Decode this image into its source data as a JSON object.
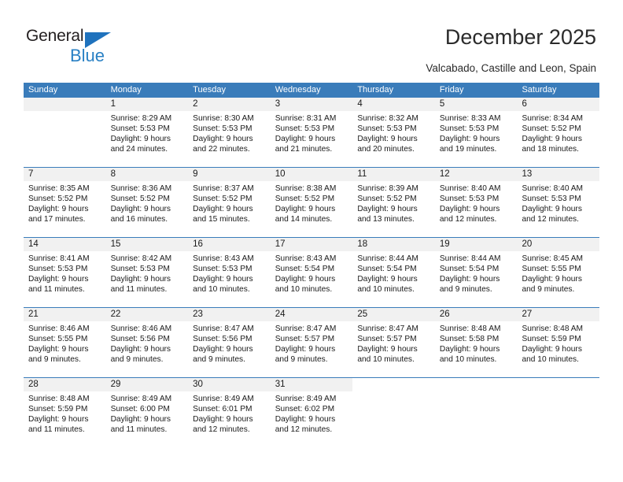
{
  "brand": {
    "name_top": "General",
    "name_bottom": "Blue",
    "accent_color": "#2980c4",
    "triangle_color": "#1f72bd"
  },
  "header": {
    "title": "December 2025",
    "subtitle": "Valcabado, Castille and Leon, Spain"
  },
  "calendar": {
    "header_bg": "#3a7cba",
    "daynum_bg": "#f1f1f1",
    "weekdays": [
      "Sunday",
      "Monday",
      "Tuesday",
      "Wednesday",
      "Thursday",
      "Friday",
      "Saturday"
    ],
    "weeks": [
      [
        {
          "day": "",
          "lines": []
        },
        {
          "day": "1",
          "lines": [
            "Sunrise: 8:29 AM",
            "Sunset: 5:53 PM",
            "Daylight: 9 hours",
            "and 24 minutes."
          ]
        },
        {
          "day": "2",
          "lines": [
            "Sunrise: 8:30 AM",
            "Sunset: 5:53 PM",
            "Daylight: 9 hours",
            "and 22 minutes."
          ]
        },
        {
          "day": "3",
          "lines": [
            "Sunrise: 8:31 AM",
            "Sunset: 5:53 PM",
            "Daylight: 9 hours",
            "and 21 minutes."
          ]
        },
        {
          "day": "4",
          "lines": [
            "Sunrise: 8:32 AM",
            "Sunset: 5:53 PM",
            "Daylight: 9 hours",
            "and 20 minutes."
          ]
        },
        {
          "day": "5",
          "lines": [
            "Sunrise: 8:33 AM",
            "Sunset: 5:53 PM",
            "Daylight: 9 hours",
            "and 19 minutes."
          ]
        },
        {
          "day": "6",
          "lines": [
            "Sunrise: 8:34 AM",
            "Sunset: 5:52 PM",
            "Daylight: 9 hours",
            "and 18 minutes."
          ]
        }
      ],
      [
        {
          "day": "7",
          "lines": [
            "Sunrise: 8:35 AM",
            "Sunset: 5:52 PM",
            "Daylight: 9 hours",
            "and 17 minutes."
          ]
        },
        {
          "day": "8",
          "lines": [
            "Sunrise: 8:36 AM",
            "Sunset: 5:52 PM",
            "Daylight: 9 hours",
            "and 16 minutes."
          ]
        },
        {
          "day": "9",
          "lines": [
            "Sunrise: 8:37 AM",
            "Sunset: 5:52 PM",
            "Daylight: 9 hours",
            "and 15 minutes."
          ]
        },
        {
          "day": "10",
          "lines": [
            "Sunrise: 8:38 AM",
            "Sunset: 5:52 PM",
            "Daylight: 9 hours",
            "and 14 minutes."
          ]
        },
        {
          "day": "11",
          "lines": [
            "Sunrise: 8:39 AM",
            "Sunset: 5:52 PM",
            "Daylight: 9 hours",
            "and 13 minutes."
          ]
        },
        {
          "day": "12",
          "lines": [
            "Sunrise: 8:40 AM",
            "Sunset: 5:53 PM",
            "Daylight: 9 hours",
            "and 12 minutes."
          ]
        },
        {
          "day": "13",
          "lines": [
            "Sunrise: 8:40 AM",
            "Sunset: 5:53 PM",
            "Daylight: 9 hours",
            "and 12 minutes."
          ]
        }
      ],
      [
        {
          "day": "14",
          "lines": [
            "Sunrise: 8:41 AM",
            "Sunset: 5:53 PM",
            "Daylight: 9 hours",
            "and 11 minutes."
          ]
        },
        {
          "day": "15",
          "lines": [
            "Sunrise: 8:42 AM",
            "Sunset: 5:53 PM",
            "Daylight: 9 hours",
            "and 11 minutes."
          ]
        },
        {
          "day": "16",
          "lines": [
            "Sunrise: 8:43 AM",
            "Sunset: 5:53 PM",
            "Daylight: 9 hours",
            "and 10 minutes."
          ]
        },
        {
          "day": "17",
          "lines": [
            "Sunrise: 8:43 AM",
            "Sunset: 5:54 PM",
            "Daylight: 9 hours",
            "and 10 minutes."
          ]
        },
        {
          "day": "18",
          "lines": [
            "Sunrise: 8:44 AM",
            "Sunset: 5:54 PM",
            "Daylight: 9 hours",
            "and 10 minutes."
          ]
        },
        {
          "day": "19",
          "lines": [
            "Sunrise: 8:44 AM",
            "Sunset: 5:54 PM",
            "Daylight: 9 hours",
            "and 9 minutes."
          ]
        },
        {
          "day": "20",
          "lines": [
            "Sunrise: 8:45 AM",
            "Sunset: 5:55 PM",
            "Daylight: 9 hours",
            "and 9 minutes."
          ]
        }
      ],
      [
        {
          "day": "21",
          "lines": [
            "Sunrise: 8:46 AM",
            "Sunset: 5:55 PM",
            "Daylight: 9 hours",
            "and 9 minutes."
          ]
        },
        {
          "day": "22",
          "lines": [
            "Sunrise: 8:46 AM",
            "Sunset: 5:56 PM",
            "Daylight: 9 hours",
            "and 9 minutes."
          ]
        },
        {
          "day": "23",
          "lines": [
            "Sunrise: 8:47 AM",
            "Sunset: 5:56 PM",
            "Daylight: 9 hours",
            "and 9 minutes."
          ]
        },
        {
          "day": "24",
          "lines": [
            "Sunrise: 8:47 AM",
            "Sunset: 5:57 PM",
            "Daylight: 9 hours",
            "and 9 minutes."
          ]
        },
        {
          "day": "25",
          "lines": [
            "Sunrise: 8:47 AM",
            "Sunset: 5:57 PM",
            "Daylight: 9 hours",
            "and 10 minutes."
          ]
        },
        {
          "day": "26",
          "lines": [
            "Sunrise: 8:48 AM",
            "Sunset: 5:58 PM",
            "Daylight: 9 hours",
            "and 10 minutes."
          ]
        },
        {
          "day": "27",
          "lines": [
            "Sunrise: 8:48 AM",
            "Sunset: 5:59 PM",
            "Daylight: 9 hours",
            "and 10 minutes."
          ]
        }
      ],
      [
        {
          "day": "28",
          "lines": [
            "Sunrise: 8:48 AM",
            "Sunset: 5:59 PM",
            "Daylight: 9 hours",
            "and 11 minutes."
          ]
        },
        {
          "day": "29",
          "lines": [
            "Sunrise: 8:49 AM",
            "Sunset: 6:00 PM",
            "Daylight: 9 hours",
            "and 11 minutes."
          ]
        },
        {
          "day": "30",
          "lines": [
            "Sunrise: 8:49 AM",
            "Sunset: 6:01 PM",
            "Daylight: 9 hours",
            "and 12 minutes."
          ]
        },
        {
          "day": "31",
          "lines": [
            "Sunrise: 8:49 AM",
            "Sunset: 6:02 PM",
            "Daylight: 9 hours",
            "and 12 minutes."
          ]
        },
        {
          "day": "",
          "lines": []
        },
        {
          "day": "",
          "lines": []
        },
        {
          "day": "",
          "lines": []
        }
      ]
    ]
  }
}
